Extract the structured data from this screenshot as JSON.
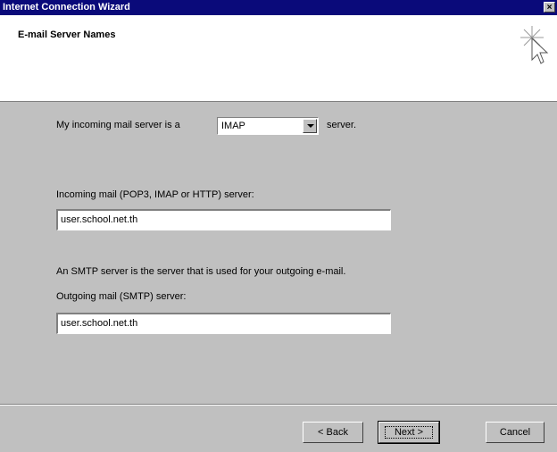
{
  "window": {
    "title": "Internet Connection Wizard",
    "close_label": "×"
  },
  "header": {
    "title": "E-mail Server Names"
  },
  "incoming_type": {
    "prefix": "My incoming mail server is a",
    "selected": "IMAP",
    "suffix": "server."
  },
  "incoming_server": {
    "label": "Incoming mail (POP3, IMAP or HTTP) server:",
    "value": "user.school.net.th"
  },
  "smtp_note": "An SMTP server is the server that is used for your outgoing e-mail.",
  "outgoing_server": {
    "label": "Outgoing mail (SMTP) server:",
    "value": "user.school.net.th"
  },
  "buttons": {
    "back": "< Back",
    "next": "Next >",
    "cancel": "Cancel"
  }
}
